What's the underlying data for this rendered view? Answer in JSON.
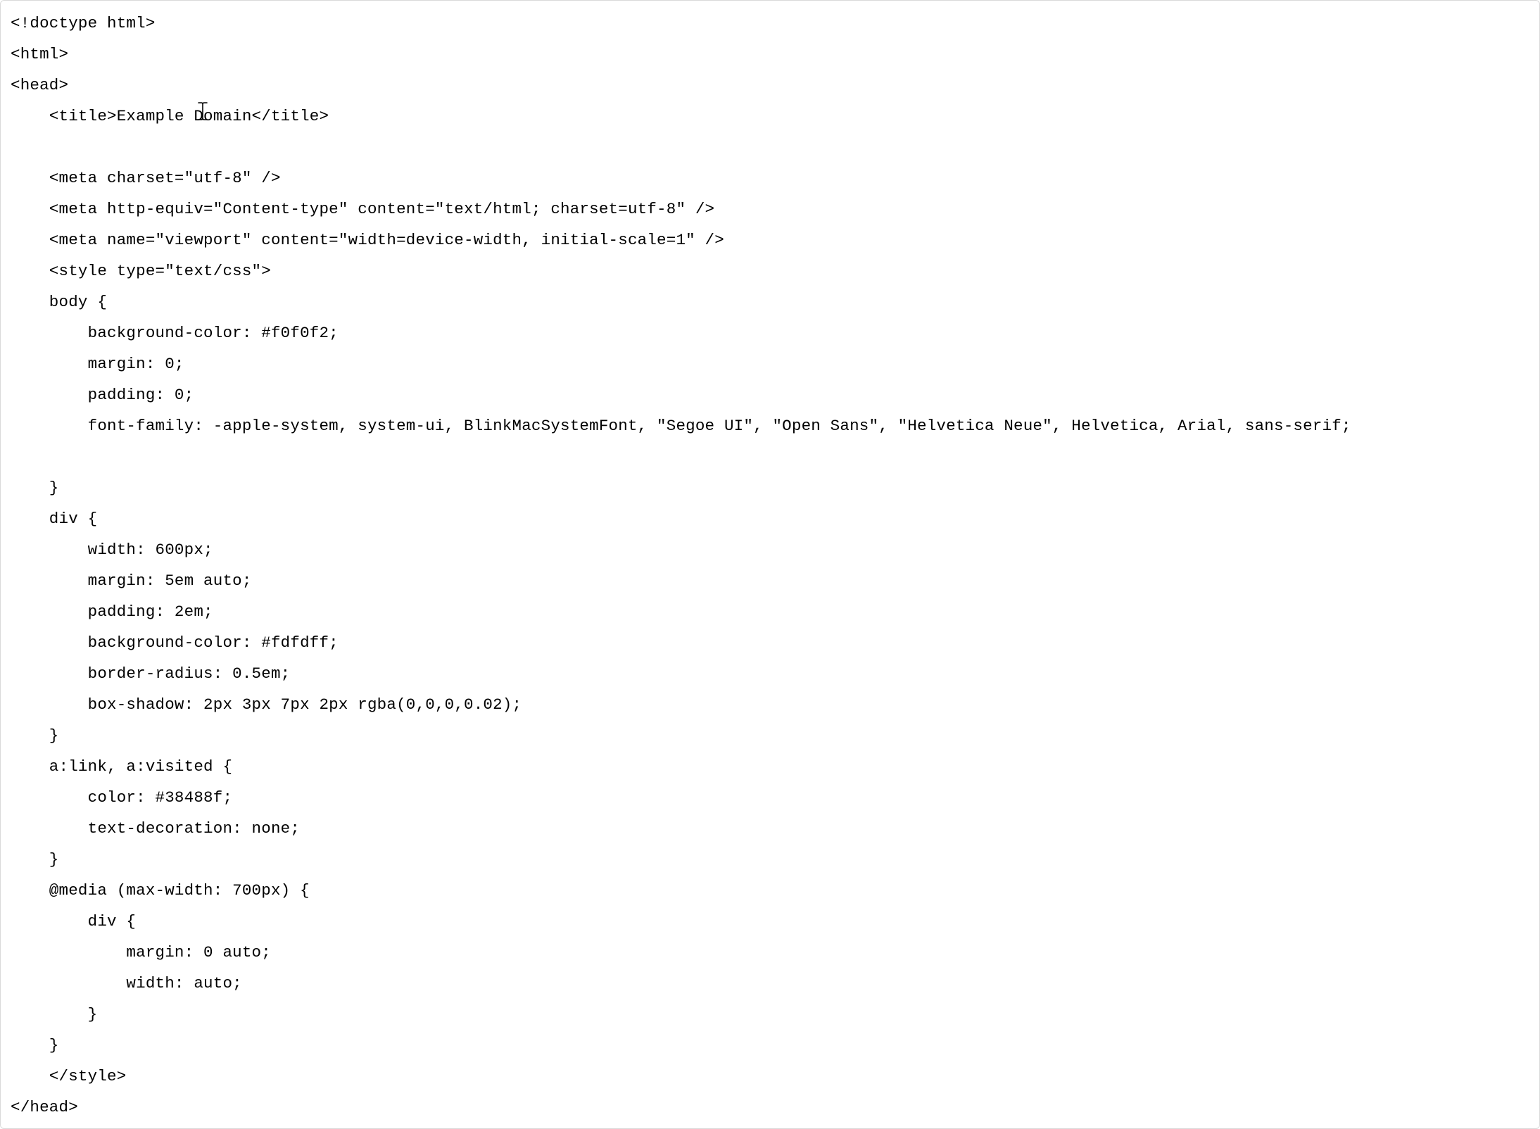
{
  "code_lines": [
    "<!doctype html>",
    "<html>",
    "<head>",
    "    <title>Example Domain</title>",
    "",
    "    <meta charset=\"utf-8\" />",
    "    <meta http-equiv=\"Content-type\" content=\"text/html; charset=utf-8\" />",
    "    <meta name=\"viewport\" content=\"width=device-width, initial-scale=1\" />",
    "    <style type=\"text/css\">",
    "    body {",
    "        background-color: #f0f0f2;",
    "        margin: 0;",
    "        padding: 0;",
    "        font-family: -apple-system, system-ui, BlinkMacSystemFont, \"Segoe UI\", \"Open Sans\", \"Helvetica Neue\", Helvetica, Arial, sans-serif;",
    "        ",
    "    }",
    "    div {",
    "        width: 600px;",
    "        margin: 5em auto;",
    "        padding: 2em;",
    "        background-color: #fdfdff;",
    "        border-radius: 0.5em;",
    "        box-shadow: 2px 3px 7px 2px rgba(0,0,0,0.02);",
    "    }",
    "    a:link, a:visited {",
    "        color: #38488f;",
    "        text-decoration: none;",
    "    }",
    "    @media (max-width: 700px) {",
    "        div {",
    "            margin: 0 auto;",
    "            width: auto;",
    "        }",
    "    }",
    "    </style>    ",
    "</head>"
  ]
}
